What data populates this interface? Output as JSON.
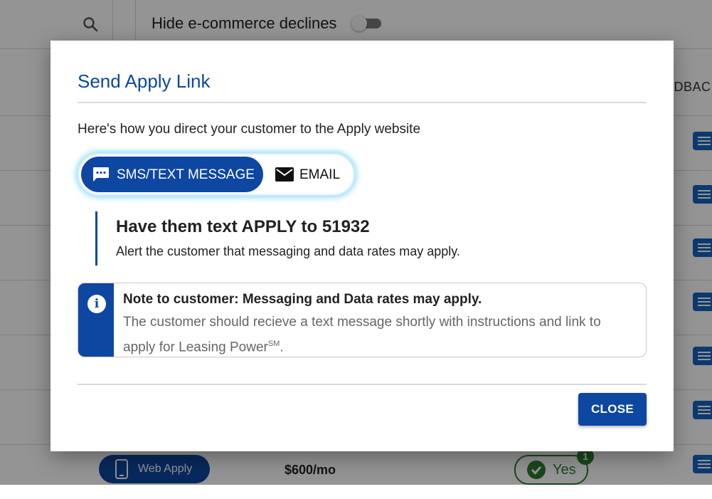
{
  "background": {
    "filter_label": "Hide e-commerce declines",
    "column_header": "EDBAC",
    "row": {
      "apply_button": "Web Apply",
      "price": "$600/mo",
      "status": "Yes",
      "badge": "1"
    }
  },
  "modal": {
    "title": "Send Apply Link",
    "intro": "Here's how you direct your customer to the Apply website",
    "options": {
      "sms": "SMS/TEXT MESSAGE",
      "email": "EMAIL"
    },
    "selected_option": "sms",
    "instruction": {
      "heading": "Have them text APPLY to 51932",
      "subtext": "Alert the customer that messaging and data rates may apply."
    },
    "note": {
      "heading": "Note to customer: Messaging and Data rates may apply.",
      "body": "The customer should recieve a text message shortly with instructions and link to apply for Leasing Power",
      "superscript": "SM",
      "suffix": "."
    },
    "close_label": "CLOSE"
  },
  "colors": {
    "primary": "#0d47a1",
    "accent_glow": "#9ddff7",
    "success": "#2e7d32"
  }
}
